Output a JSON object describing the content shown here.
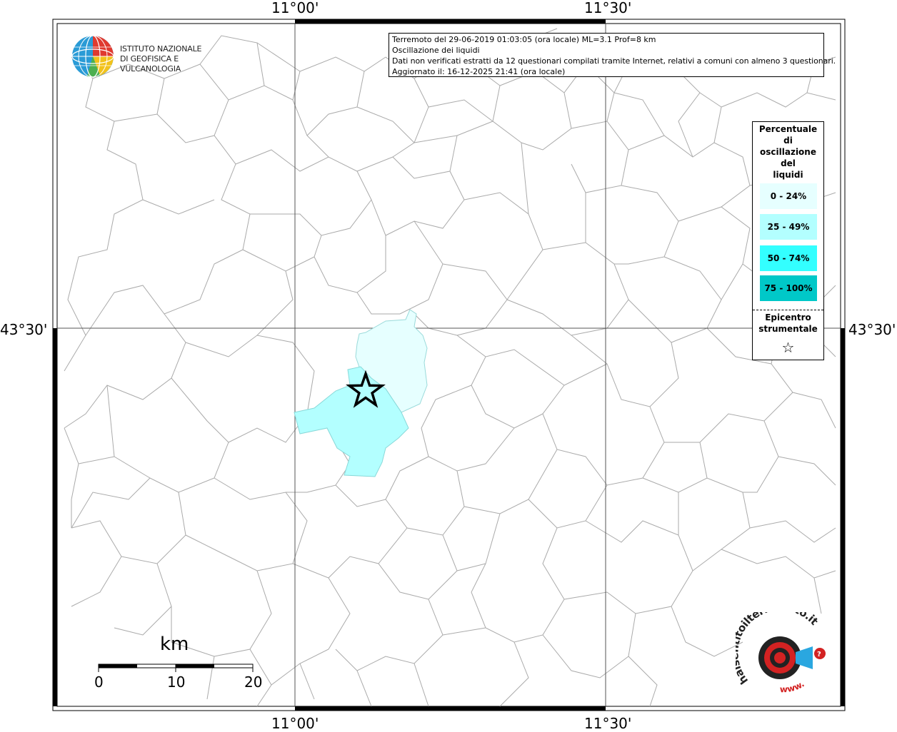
{
  "map": {
    "lon_ticks": [
      "11°00'",
      "11°30'"
    ],
    "lat_ticks": [
      "43°30'"
    ]
  },
  "info": {
    "line1": "Terremoto del 29-06-2019 01:03:05 (ora locale) ML=3.1 Prof=8 km",
    "line2": "Oscillazione dei liquidi",
    "line3": "Dati non verificati estratti da 12 questionari compilati tramite Internet, relativi a comuni con almeno 3 questionari.",
    "line4": "Aggiornato il: 16-12-2025 21:41 (ora locale)"
  },
  "legend": {
    "title": [
      "Percentuale",
      "di",
      "oscillazione",
      "del",
      "liquidi"
    ],
    "classes": [
      {
        "label": "0 - 24%",
        "color": "#e6ffff"
      },
      {
        "label": "25 - 49%",
        "color": "#b3ffff"
      },
      {
        "label": "50 - 74%",
        "color": "#33ffff"
      },
      {
        "label": "75 - 100%",
        "color": "#00c8c8"
      }
    ],
    "epicenter_title": [
      "Epicentro",
      "strumentale"
    ],
    "epicenter_symbol": "☆"
  },
  "logo_ingv": {
    "line1": "ISTITUTO NAZIONALE",
    "line2": "DI GEOFISICA E VULCANOLOGIA"
  },
  "scale_bar": {
    "unit": "km",
    "ticks": [
      "0",
      "10",
      "20"
    ]
  },
  "logo_hsi": {
    "text": "haisentitoilterremoto.it",
    "url_text": "www."
  },
  "colors": {
    "zone_light": "#e6ffff",
    "zone_mid": "#b3ffff",
    "border_gray": "#aaaaaa"
  }
}
